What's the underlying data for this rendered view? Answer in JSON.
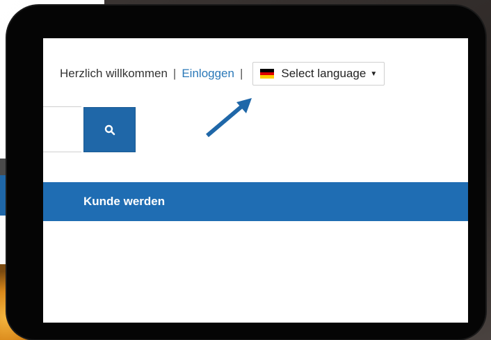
{
  "header": {
    "welcome_text": "Herzlich willkommen",
    "separator": "|",
    "login_link": "Einloggen",
    "language_select": {
      "label": "Select language",
      "flag_icon": "germany-flag-icon"
    }
  },
  "search": {
    "button_icon": "search-icon",
    "input_value": ""
  },
  "nav": {
    "items": [
      {
        "label": "Kunde werden"
      }
    ]
  },
  "colors": {
    "accent": "#1f6db3",
    "link": "#2a78b8",
    "arrow": "#1f67a8"
  }
}
